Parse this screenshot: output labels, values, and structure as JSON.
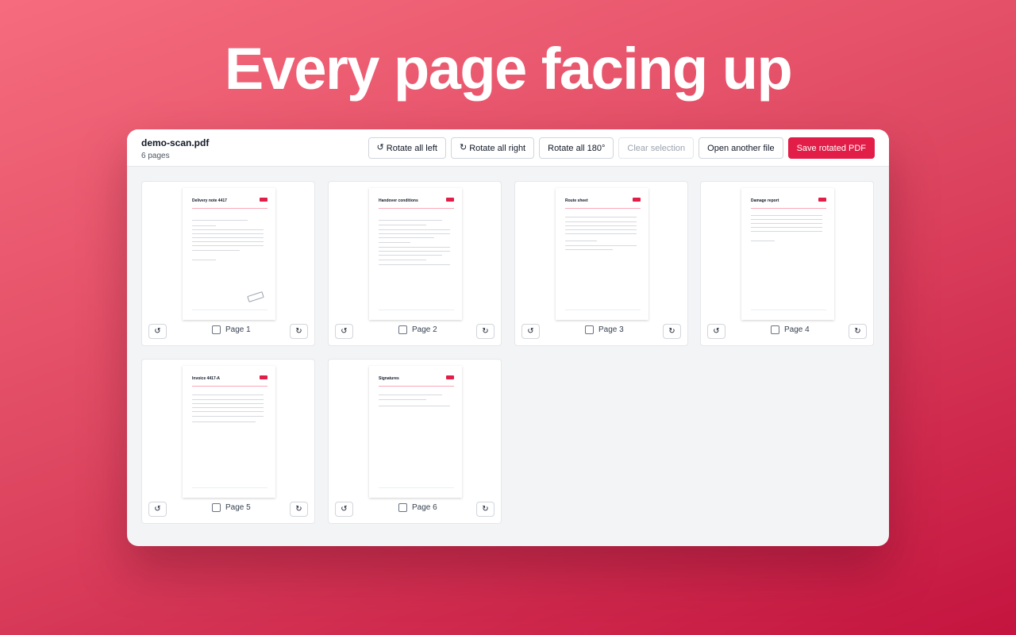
{
  "headline": "Every page facing up",
  "file": {
    "name": "demo-scan.pdf",
    "pages_text": "6 pages"
  },
  "toolbar": {
    "rotate_all_left": "Rotate all left",
    "rotate_all_right": "Rotate all right",
    "rotate_all_180": "Rotate all 180°",
    "clear_selection": "Clear selection",
    "open_another": "Open another file",
    "save": "Save rotated PDF"
  },
  "icons": {
    "rotate_left": "rotate-left-icon",
    "rotate_right": "rotate-right-icon"
  },
  "glyphs": {
    "rotate_left": "↺",
    "rotate_right": "↻"
  },
  "colors": {
    "accent": "#e11d48",
    "background_top": "#f66c7e",
    "background_bottom": "#c4143f"
  },
  "pages": [
    {
      "label": "Page 1",
      "thumb_title": "Delivery note 4417",
      "selected": false
    },
    {
      "label": "Page 2",
      "thumb_title": "Handover conditions",
      "selected": false
    },
    {
      "label": "Page 3",
      "thumb_title": "Route sheet",
      "selected": false
    },
    {
      "label": "Page 4",
      "thumb_title": "Damage report",
      "selected": false
    },
    {
      "label": "Page 5",
      "thumb_title": "Invoice 4417-A",
      "selected": false
    },
    {
      "label": "Page 6",
      "thumb_title": "Signatures",
      "selected": false
    }
  ]
}
